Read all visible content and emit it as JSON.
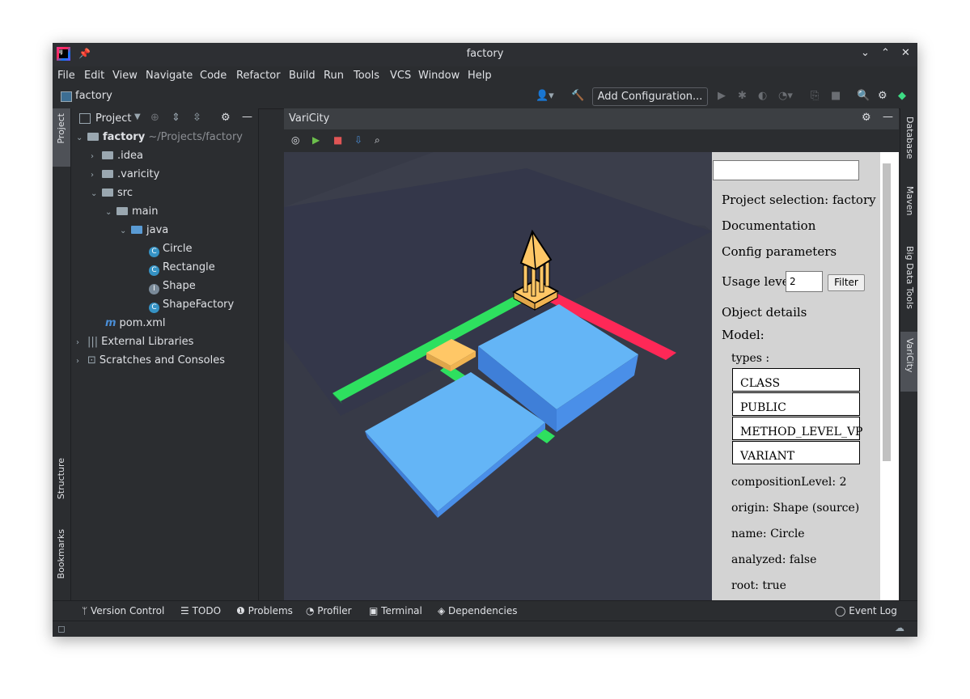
{
  "window": {
    "title": "factory"
  },
  "menu": [
    "File",
    "Edit",
    "View",
    "Navigate",
    "Code",
    "Refactor",
    "Build",
    "Run",
    "Tools",
    "VCS",
    "Window",
    "Help"
  ],
  "navbar": {
    "breadcrumb": "factory",
    "add_configuration": "Add Configuration..."
  },
  "left_stripe": {
    "project": "Project",
    "structure": "Structure",
    "bookmarks": "Bookmarks"
  },
  "project_panel": {
    "title": "Project",
    "root_name": "factory",
    "root_path": "~/Projects/factory",
    "items": [
      ".idea",
      ".varicity",
      "src",
      "main",
      "java",
      "Circle",
      "Rectangle",
      "Shape",
      "ShapeFactory",
      "pom.xml",
      "External Libraries",
      "Scratches and Consoles"
    ]
  },
  "varicity": {
    "title": "VariCity",
    "sidebar": {
      "project_selection": "Project selection: factory",
      "documentation": "Documentation",
      "config_parameters": "Config parameters",
      "usage_level_label": "Usage level",
      "usage_level_value": "2",
      "filter": "Filter",
      "object_details": "Object details",
      "model": "Model:",
      "types_label": "types :",
      "types": [
        "CLASS",
        "PUBLIC",
        "METHOD_LEVEL_VP",
        "VARIANT"
      ],
      "composition_level": "compositionLevel: 2",
      "origin": "origin: Shape (source)",
      "name": "name: Circle",
      "analyzed": "analyzed: false",
      "root": "root: true"
    }
  },
  "right_stripe": {
    "database": "Database",
    "maven": "Maven",
    "big_data_tools": "Big Data Tools",
    "varicity": "VariCity"
  },
  "bottom_tabs": {
    "version_control": "Version Control",
    "todo": "TODO",
    "problems": "Problems",
    "profiler": "Profiler",
    "terminal": "Terminal",
    "dependencies": "Dependencies",
    "event_log": "Event Log"
  },
  "colors": {
    "bg": "#2b2d30",
    "viewport": "#373a47",
    "blue_block": "#64b5f6",
    "green_road": "#2ee05f",
    "red_road": "#fe2857",
    "yellow": "#ffc766"
  }
}
